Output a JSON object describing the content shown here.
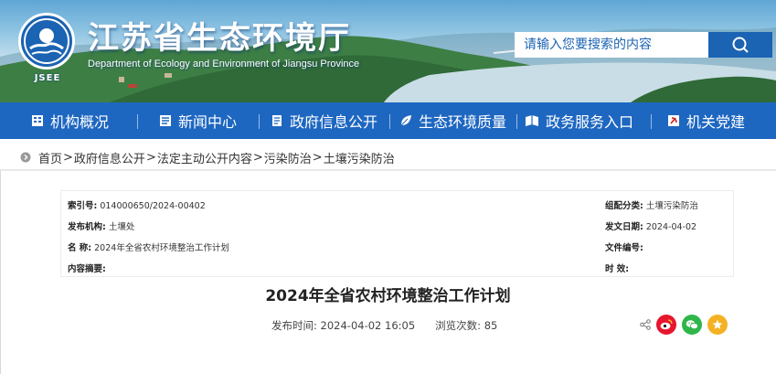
{
  "header": {
    "site_title": "江苏省生态环境厅",
    "site_subtitle": "Department of Ecology and Environment of Jiangsu Province",
    "logo_text": "JSEE",
    "search_placeholder": "请输入您要搜索的内容",
    "colors": {
      "brand_blue": "#1e67c1",
      "nav_blue": "#1e67c1"
    }
  },
  "nav": {
    "items": [
      {
        "label": "机构概况",
        "icon": "building-icon"
      },
      {
        "label": "新闻中心",
        "icon": "news-icon"
      },
      {
        "label": "政府信息公开",
        "icon": "document-icon"
      },
      {
        "label": "生态环境质量",
        "icon": "leaf-icon"
      },
      {
        "label": "政务服务入口",
        "icon": "service-icon"
      },
      {
        "label": "机关党建",
        "icon": "party-icon"
      }
    ]
  },
  "breadcrumb": {
    "items": [
      "首页",
      "政府信息公开",
      "法定主动公开内容",
      "污染防治",
      "土壤污染防治"
    ],
    "separator": ">"
  },
  "info": {
    "index_no_label": "索引号:",
    "index_no": "014000650/2024-00402",
    "category_label": "组配分类:",
    "category": "土壤污染防治",
    "publisher_label": "发布机构:",
    "publisher": "土壤处",
    "issue_date_label": "发文日期:",
    "issue_date": "2024-04-02",
    "name_label": "名 称:",
    "name": "2024年全省农村环境整治工作计划",
    "doc_no_label": "文件编号:",
    "doc_no": "",
    "summary_label": "内容摘要:",
    "summary": "",
    "validity_label": "时 效:",
    "validity": ""
  },
  "article": {
    "title": "2024年全省农村环境整治工作计划",
    "published_label": "发布时间:",
    "published": "2024-04-02 16:05",
    "views_label": "浏览次数:",
    "views": "85"
  },
  "share": {
    "buttons": [
      {
        "name": "weibo",
        "color": "#e6162d"
      },
      {
        "name": "wechat",
        "color": "#2fb64a"
      },
      {
        "name": "favorite",
        "color": "#f4b124"
      }
    ]
  }
}
